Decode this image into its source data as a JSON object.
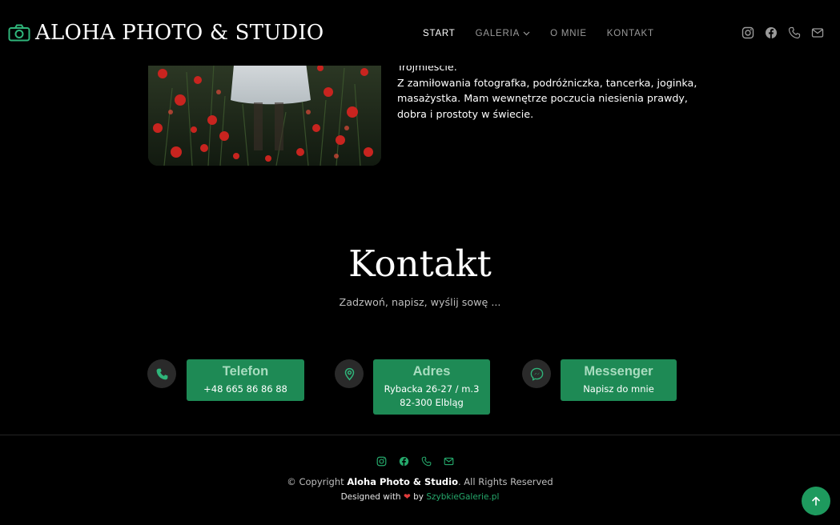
{
  "brand": {
    "title": "ALOHA PHOTO & STUDIO",
    "icon": "camera-icon"
  },
  "nav": {
    "items": [
      {
        "label": "START",
        "active": true
      },
      {
        "label": "GALERIA",
        "dropdown": true
      },
      {
        "label": "O MNIE"
      },
      {
        "label": "KONTAKT"
      }
    ]
  },
  "social_icons": [
    "instagram-icon",
    "facebook-icon",
    "phone-icon",
    "mail-icon"
  ],
  "about": {
    "lines": [
      "Trójmieście.",
      "Z zamiłowania fotografka, podróżniczka, tancerka, joginka,",
      "masażystka. Mam wewnętrze poczucia niesienia prawdy,",
      "dobra i prostoty w świecie."
    ]
  },
  "contact": {
    "title": "Kontakt",
    "subtitle": "Zadzwoń, napisz, wyślij sowę ...",
    "cards": [
      {
        "icon": "phone-icon",
        "title": "Telefon",
        "lines": [
          "+48 665 86 86 88"
        ]
      },
      {
        "icon": "map-pin-icon",
        "title": "Adres",
        "lines": [
          "Rybacka 26-27 / m.3",
          "82-300 Elbląg"
        ]
      },
      {
        "icon": "messenger-icon",
        "title": "Messenger",
        "lines": [
          "Napisz do mnie"
        ]
      }
    ]
  },
  "footer": {
    "copyright_prefix": "© Copyright ",
    "copyright_brand": "Aloha Photo & Studio",
    "copyright_suffix": ". All Rights Reserved",
    "designed_prefix": "Designed with ",
    "designed_by": " by ",
    "designed_link": "SzybkieGalerie.pl"
  },
  "colors": {
    "accent": "#1e8a55",
    "accent_light": "#25a86b",
    "background": "#000000"
  }
}
